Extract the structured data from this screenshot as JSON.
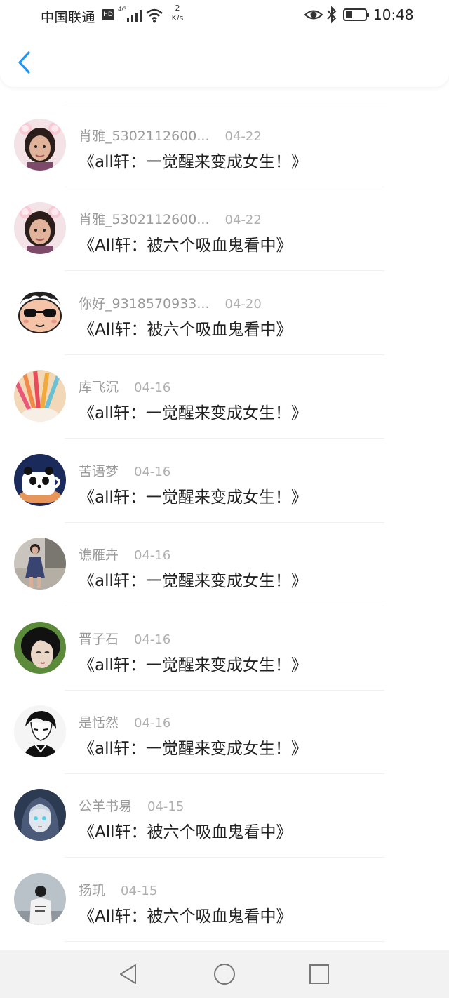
{
  "status": {
    "carrier": "中国联通",
    "hd": "HD",
    "network": "4G",
    "speed_value": "2",
    "speed_unit": "K/s",
    "time": "10:48",
    "icons": [
      "signal-icon",
      "wifi-icon",
      "eye-icon",
      "bluetooth-icon",
      "battery-icon"
    ]
  },
  "header": {
    "back_icon": "chevron-left-icon",
    "accent": "#2196f3"
  },
  "items": [
    {
      "name": "肖雅_5302112600...",
      "date": "04-22",
      "title": "《all轩：一觉醒来变成女生！》",
      "avatar": "girl-photo-avatar"
    },
    {
      "name": "肖雅_5302112600...",
      "date": "04-22",
      "title": "《All轩：被六个吸血鬼看中》",
      "avatar": "girl-photo-avatar"
    },
    {
      "name": "你好_9318570933...",
      "date": "04-20",
      "title": "《All轩：被六个吸血鬼看中》",
      "avatar": "cartoon-sunglasses-avatar"
    },
    {
      "name": "库飞沉",
      "date": "04-16",
      "title": "《all轩：一觉醒来变成女生！》",
      "avatar": "pencils-avatar"
    },
    {
      "name": "苦语梦",
      "date": "04-16",
      "title": "《all轩：一觉醒来变成女生！》",
      "avatar": "panda-cup-avatar"
    },
    {
      "name": "谯雁卉",
      "date": "04-16",
      "title": "《all轩：一觉醒来变成女生！》",
      "avatar": "girl-dress-avatar"
    },
    {
      "name": "晋子石",
      "date": "04-16",
      "title": "《all轩：一觉醒来变成女生！》",
      "avatar": "doll-avatar"
    },
    {
      "name": "是恬然",
      "date": "04-16",
      "title": "《all轩：一觉醒来变成女生！》",
      "avatar": "sketch-boy-avatar"
    },
    {
      "name": "公羊书易",
      "date": "04-15",
      "title": "《All轩：被六个吸血鬼看中》",
      "avatar": "anime-hood-avatar"
    },
    {
      "name": "扬玑",
      "date": "04-15",
      "title": "《All轩：被六个吸血鬼看中》",
      "avatar": "boy-back-avatar"
    }
  ],
  "nav": {
    "buttons": [
      "back-triangle-icon",
      "home-circle-icon",
      "recents-square-icon"
    ]
  }
}
